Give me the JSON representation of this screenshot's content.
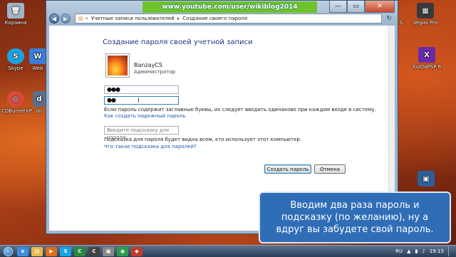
{
  "desktop": {
    "left_icons": [
      {
        "label": "Корзина",
        "icon": "recycle-bin-icon",
        "color": "#9fb3c9",
        "glyph": "🗑"
      },
      {
        "label": "Skype",
        "icon": "skype-icon",
        "color": "#1aa3e3",
        "glyph": "S"
      },
      {
        "label": "Web",
        "icon": "web-icon",
        "color": "#3b7dd8",
        "glyph": "W"
      },
      {
        "label": "CDBurnerXP",
        "icon": "cdburner-icon",
        "color": "#d84a3a",
        "glyph": "◎"
      },
      {
        "label": "dn",
        "icon": "app-icon",
        "color": "#5b6f8a",
        "glyph": "d"
      }
    ],
    "right_icons": [
      {
        "label": "Vegas Pro",
        "icon": "vegas-pro-icon",
        "color": "#3a3a3a",
        "glyph": "▦"
      },
      {
        "label": "XviD4PSP 6",
        "icon": "xvid4psp-icon",
        "color": "#6a2aa8",
        "glyph": "X"
      },
      {
        "label": "S",
        "icon": "app-icon",
        "color": "#7b8aa0",
        "glyph": "S"
      }
    ]
  },
  "youtube_banner": "www.youtube.com/user/wikiblog2014",
  "window": {
    "breadcrumb": [
      "Учетные записи пользователей",
      "Создание своего пароля"
    ],
    "heading": "Создание пароля своей учетной записи",
    "user": {
      "name": "BanzayCS",
      "role": "Администратор"
    },
    "password_value": "●●●",
    "confirm_value": "●●",
    "case_note": "Если пароль содержит заглавные буквы, их следует вводить одинаково при каждом входе в систему.",
    "strong_link": "Как создать надежный пароль",
    "hint_placeholder": "Введите подсказку для пароля",
    "hint_note": "Подсказка для пароля будет видна всем, кто использует этот компьютер.",
    "hint_link": "Что такое подсказка для паролей?",
    "create_button": "Создать пароль",
    "cancel_button": "Отмена",
    "controls": {
      "minimize": "—",
      "maximize": "▭",
      "close": "✕"
    }
  },
  "caption": "Вводим два раза пароль и\nподсказку (по желанию), ну а\nвдруг вы забудете свой пароль.",
  "taskbar": {
    "apps": [
      {
        "icon": "ie-icon",
        "color": "#3b8ee0",
        "glyph": "e"
      },
      {
        "icon": "explorer-icon",
        "color": "#e8b94a",
        "glyph": "▤"
      },
      {
        "icon": "media-player-icon",
        "color": "#e06a1a",
        "glyph": "▶"
      },
      {
        "icon": "skype-icon",
        "color": "#1aa3e3",
        "glyph": "S"
      },
      {
        "icon": "app-icon",
        "color": "#2a8a3a",
        "glyph": "C"
      },
      {
        "icon": "app-icon",
        "color": "#444444",
        "glyph": "C"
      },
      {
        "icon": "app-icon",
        "color": "#888888",
        "glyph": "▣"
      },
      {
        "icon": "camtasia-icon",
        "color": "#2d9c4a",
        "glyph": "◉"
      },
      {
        "icon": "app-icon",
        "color": "#c13a2a",
        "glyph": "◆"
      }
    ],
    "language": "RU",
    "time": "19:15"
  }
}
